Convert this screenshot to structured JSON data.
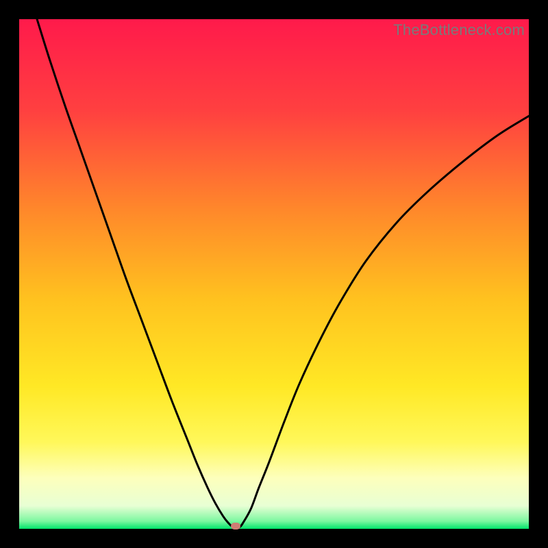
{
  "watermark": "TheBottleneck.com",
  "axes": {
    "x_range": [
      0,
      100
    ],
    "y_range": [
      0,
      100
    ]
  },
  "gradient_stops": [
    {
      "offset": 0.0,
      "color": "#ff1a4b"
    },
    {
      "offset": 0.18,
      "color": "#ff4040"
    },
    {
      "offset": 0.38,
      "color": "#ff8a2a"
    },
    {
      "offset": 0.55,
      "color": "#ffc21f"
    },
    {
      "offset": 0.72,
      "color": "#ffe825"
    },
    {
      "offset": 0.83,
      "color": "#fff85a"
    },
    {
      "offset": 0.9,
      "color": "#fdffbc"
    },
    {
      "offset": 0.955,
      "color": "#e8ffd4"
    },
    {
      "offset": 0.985,
      "color": "#7cf7a0"
    },
    {
      "offset": 1.0,
      "color": "#00e46b"
    }
  ],
  "chart_data": {
    "type": "line",
    "title": "",
    "xlabel": "",
    "ylabel": "",
    "xlim": [
      0,
      100
    ],
    "ylim": [
      0,
      100
    ],
    "series": [
      {
        "name": "bottleneck-curve",
        "x": [
          3.5,
          6,
          9,
          12,
          15,
          18,
          21,
          24,
          27,
          30,
          33,
          35,
          37,
          38.5,
          40,
          41,
          42,
          43.2,
          44,
          45.5,
          47,
          49,
          52,
          55,
          59,
          63,
          68,
          74,
          80,
          87,
          94,
          100
        ],
        "y": [
          100,
          92,
          83,
          74.5,
          66,
          57.5,
          49,
          41,
          33,
          25,
          17.5,
          12.5,
          8,
          5,
          2.5,
          1.2,
          0.3,
          0.3,
          1.3,
          4,
          8,
          13,
          21,
          28.5,
          37,
          44.5,
          52.5,
          60,
          66,
          72,
          77.3,
          81
        ]
      }
    ],
    "marker": {
      "x": 42.5,
      "y": 0.5,
      "color": "#cf7d74"
    },
    "annotations": []
  }
}
